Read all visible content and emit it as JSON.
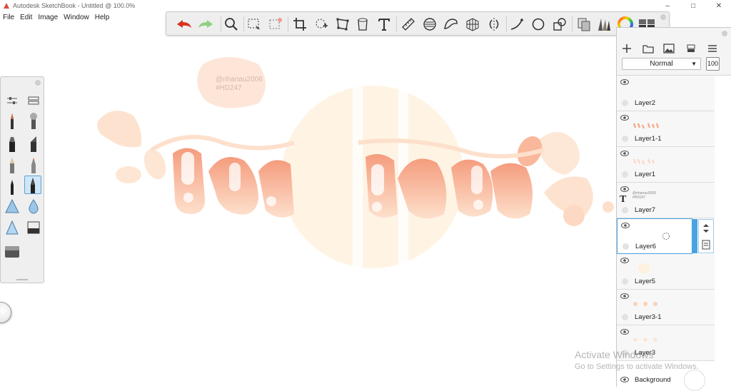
{
  "window": {
    "title": "Autodesk SketchBook - Untitled @ 100.0%",
    "controls": [
      "–",
      "□",
      "✕"
    ]
  },
  "menu": [
    "File",
    "Edit",
    "Image",
    "Window",
    "Help"
  ],
  "toolbar": {
    "tools": [
      "undo-icon",
      "redo-icon",
      "zoom-icon",
      "select-rect-icon",
      "select-magic-icon",
      "crop-icon",
      "lasso-transform-icon",
      "distort-icon",
      "fill-bucket-icon",
      "text-icon",
      "ruler-icon",
      "ellipse-guide-icon",
      "french-curve-icon",
      "perspective-icon",
      "symmetry-icon",
      "stroke-line-icon",
      "circle-shape-icon",
      "shapes-icon",
      "copy-paste-icon",
      "brush-library-icon",
      "color-wheel-icon",
      "layer-editor-icon"
    ]
  },
  "brushes": {
    "items": [
      "ink-pen-icon",
      "airbrush-icon",
      "marker-icon",
      "chisel-marker-icon",
      "pencil-icon",
      "felt-pen-icon",
      "fine-pen-icon",
      "calligraphy-pen-icon",
      "smudge-icon",
      "blur-icon",
      "sharpen-icon",
      "eraser-icon",
      "hard-eraser-icon"
    ],
    "selected": "calligraphy-pen-icon"
  },
  "canvas": {
    "watermark_line1": "@nhanau2006",
    "watermark_line2": "#HD247",
    "colors": {
      "peach": "#f7a98a",
      "light": "#ffe4d3",
      "pale": "#fff3e3",
      "blob": "#fcd4bd"
    }
  },
  "layer_panel": {
    "blend_mode": "Normal",
    "opacity": "100",
    "header_icons": [
      "add-layer-icon",
      "folder-icon",
      "image-import-icon",
      "merge-layer-icon",
      "menu-icon"
    ],
    "layers": [
      {
        "name": "Layer2"
      },
      {
        "name": "Layer1-1"
      },
      {
        "name": "Layer1"
      },
      {
        "name": "Layer7",
        "thumb_text": "@nhanau2006 #HD247"
      },
      {
        "name": "Layer6",
        "selected": true
      },
      {
        "name": "Layer5"
      },
      {
        "name": "Layer3-1"
      },
      {
        "name": "Layer3"
      },
      {
        "name": "Background"
      }
    ]
  },
  "os": {
    "activate_title": "Activate Windows",
    "activate_sub": "Go to Settings to activate Windows."
  }
}
